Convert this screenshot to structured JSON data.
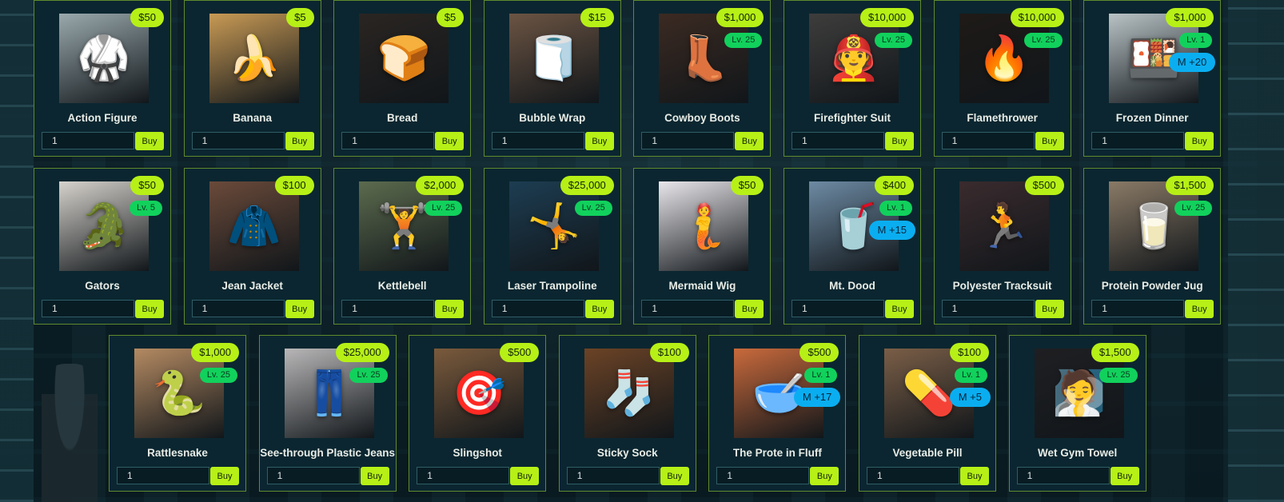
{
  "shop": {
    "rows": [
      [
        {
          "name": "Action Figure",
          "price": "$50",
          "level": "",
          "bonus": "",
          "qty": "1",
          "buy": "Buy",
          "icon": "action-figure-icon",
          "glyph": "🥋",
          "tint": "#9aa9ad"
        },
        {
          "name": "Banana",
          "price": "$5",
          "level": "",
          "bonus": "",
          "qty": "1",
          "buy": "Buy",
          "icon": "banana-icon",
          "glyph": "🍌",
          "tint": "#c89a55"
        },
        {
          "name": "Bread",
          "price": "$5",
          "level": "",
          "bonus": "",
          "qty": "1",
          "buy": "Buy",
          "icon": "bread-icon",
          "glyph": "🍞",
          "tint": "#2a2522"
        },
        {
          "name": "Bubble Wrap",
          "price": "$15",
          "level": "",
          "bonus": "",
          "qty": "1",
          "buy": "Buy",
          "icon": "bubble-wrap-icon",
          "glyph": "🧻",
          "tint": "#6b5443"
        },
        {
          "name": "Cowboy Boots",
          "price": "$1,000",
          "level": "Lv. 25",
          "bonus": "",
          "qty": "1",
          "buy": "Buy",
          "icon": "cowboy-boots-icon",
          "glyph": "👢",
          "tint": "#3b2a22"
        },
        {
          "name": "Firefighter Suit",
          "price": "$10,000",
          "level": "Lv. 25",
          "bonus": "",
          "qty": "1",
          "buy": "Buy",
          "icon": "firefighter-suit-icon",
          "glyph": "🧑‍🚒",
          "tint": "#3e3d3c"
        },
        {
          "name": "Flamethrower",
          "price": "$10,000",
          "level": "Lv. 25",
          "bonus": "",
          "qty": "1",
          "buy": "Buy",
          "icon": "flamethrower-icon",
          "glyph": "🔥",
          "tint": "#1e1a17"
        },
        {
          "name": "Frozen Dinner",
          "price": "$1,000",
          "level": "Lv. 1",
          "bonus": "M +20",
          "qty": "1",
          "buy": "Buy",
          "icon": "frozen-dinner-icon",
          "glyph": "🍱",
          "tint": "#b9c3c6"
        }
      ],
      [
        {
          "name": "Gators",
          "price": "$50",
          "level": "Lv. 5",
          "bonus": "",
          "qty": "1",
          "buy": "Buy",
          "icon": "gators-icon",
          "glyph": "🐊",
          "tint": "#d6d2cc"
        },
        {
          "name": "Jean Jacket",
          "price": "$100",
          "level": "",
          "bonus": "",
          "qty": "1",
          "buy": "Buy",
          "icon": "jean-jacket-icon",
          "glyph": "🧥",
          "tint": "#6a4a3a"
        },
        {
          "name": "Kettlebell",
          "price": "$2,000",
          "level": "Lv. 25",
          "bonus": "",
          "qty": "1",
          "buy": "Buy",
          "icon": "kettlebell-icon",
          "glyph": "🏋️",
          "tint": "#5c6b4e"
        },
        {
          "name": "Laser Trampoline",
          "price": "$25,000",
          "level": "Lv. 25",
          "bonus": "",
          "qty": "1",
          "buy": "Buy",
          "icon": "laser-trampoline-icon",
          "glyph": "🤸",
          "tint": "#1d3d52"
        },
        {
          "name": "Mermaid Wig",
          "price": "$50",
          "level": "",
          "bonus": "",
          "qty": "1",
          "buy": "Buy",
          "icon": "mermaid-wig-icon",
          "glyph": "🧜",
          "tint": "#e9e6ea"
        },
        {
          "name": "Mt. Dood",
          "price": "$400",
          "level": "Lv. 1",
          "bonus": "M +15",
          "qty": "1",
          "buy": "Buy",
          "icon": "mt-dood-icon",
          "glyph": "🥤",
          "tint": "#6d8aa3"
        },
        {
          "name": "Polyester Tracksuit",
          "price": "$500",
          "level": "",
          "bonus": "",
          "qty": "1",
          "buy": "Buy",
          "icon": "polyester-tracksuit-icon",
          "glyph": "🏃",
          "tint": "#3a2b2e"
        },
        {
          "name": "Protein Powder Jug",
          "price": "$1,500",
          "level": "Lv. 25",
          "bonus": "",
          "qty": "1",
          "buy": "Buy",
          "icon": "protein-powder-jug-icon",
          "glyph": "🥛",
          "tint": "#8a7a66"
        }
      ],
      [
        {
          "name": "Rattlesnake",
          "price": "$1,000",
          "level": "Lv. 25",
          "bonus": "",
          "qty": "1",
          "buy": "Buy",
          "icon": "rattlesnake-icon",
          "glyph": "🐍",
          "tint": "#b48a62"
        },
        {
          "name": "See-through Plastic Jeans",
          "price": "$25,000",
          "level": "Lv. 25",
          "bonus": "",
          "qty": "1",
          "buy": "Buy",
          "icon": "plastic-jeans-icon",
          "glyph": "👖",
          "tint": "#b9b7b8"
        },
        {
          "name": "Slingshot",
          "price": "$500",
          "level": "",
          "bonus": "",
          "qty": "1",
          "buy": "Buy",
          "icon": "slingshot-icon",
          "glyph": "🎯",
          "tint": "#7a5a3c"
        },
        {
          "name": "Sticky Sock",
          "price": "$100",
          "level": "",
          "bonus": "",
          "qty": "1",
          "buy": "Buy",
          "icon": "sticky-sock-icon",
          "glyph": "🧦",
          "tint": "#6b4326"
        },
        {
          "name": "The Prote in Fluff",
          "price": "$500",
          "level": "Lv. 1",
          "bonus": "M +17",
          "qty": "1",
          "buy": "Buy",
          "icon": "protein-fluff-icon",
          "glyph": "🥣",
          "tint": "#c96a3c"
        },
        {
          "name": "Vegetable Pill",
          "price": "$100",
          "level": "Lv. 1",
          "bonus": "M +5",
          "qty": "1",
          "buy": "Buy",
          "icon": "vegetable-pill-icon",
          "glyph": "💊",
          "tint": "#7a5e47"
        },
        {
          "name": "Wet Gym Towel",
          "price": "$1,500",
          "level": "Lv. 25",
          "bonus": "",
          "qty": "1",
          "buy": "Buy",
          "icon": "wet-gym-towel-icon",
          "glyph": "🧖",
          "tint": "#1f1f22"
        }
      ]
    ]
  },
  "colors": {
    "card_bg": "#0b2630",
    "card_border": "#5f8a2c",
    "price_badge": "#b6f016",
    "level_badge": "#11d15c",
    "bonus_badge": "#0aaef0",
    "buy_button": "#b6f016"
  }
}
